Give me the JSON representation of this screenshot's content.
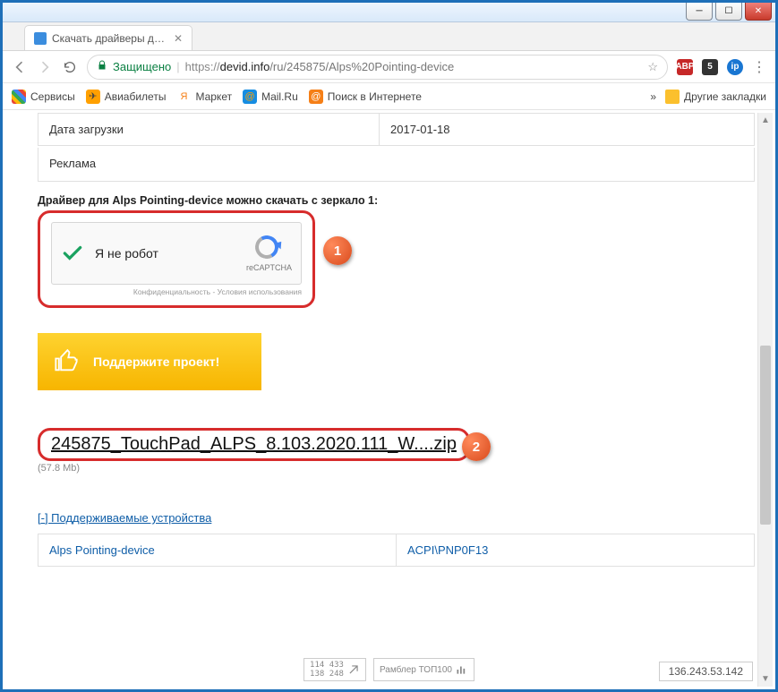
{
  "window": {
    "tab_title": "Скачать драйверы для A"
  },
  "address": {
    "secure_label": "Защищено",
    "protocol": "https",
    "host": "devid.info",
    "path": "/ru/245875/Alps%20Pointing-device"
  },
  "bookmarks": {
    "services": "Сервисы",
    "avia": "Авиабилеты",
    "market": "Маркет",
    "mailru": "Mail.Ru",
    "search": "Поиск в Интернете",
    "more_symbol": "»",
    "other": "Другие закладки"
  },
  "info_table": {
    "upload_date_label": "Дата загрузки",
    "upload_date_value": "2017-01-18",
    "ad_label": "Реклама"
  },
  "mirror_text": "Драйвер для Alps Pointing-device можно скачать с зеркало 1:",
  "recaptcha": {
    "label": "Я не робот",
    "brand": "reCAPTCHA",
    "terms": "Конфиденциальность - Условия использования"
  },
  "support_button": "Поддержите проект!",
  "download": {
    "filename": "245875_TouchPad_ALPS_8.103.2020.111_W....zip",
    "size": "(57.8 Mb)"
  },
  "supported": {
    "toggle": "[-] Поддерживаемые устройства",
    "device_name": "Alps Pointing-device",
    "device_id": "ACPI\\PNP0F13"
  },
  "footer": {
    "counter1": "114 433\n138 248",
    "rambler": "Рамблер ТОП100",
    "ip": "136.243.53.142"
  },
  "badges": {
    "one": "1",
    "two": "2"
  }
}
